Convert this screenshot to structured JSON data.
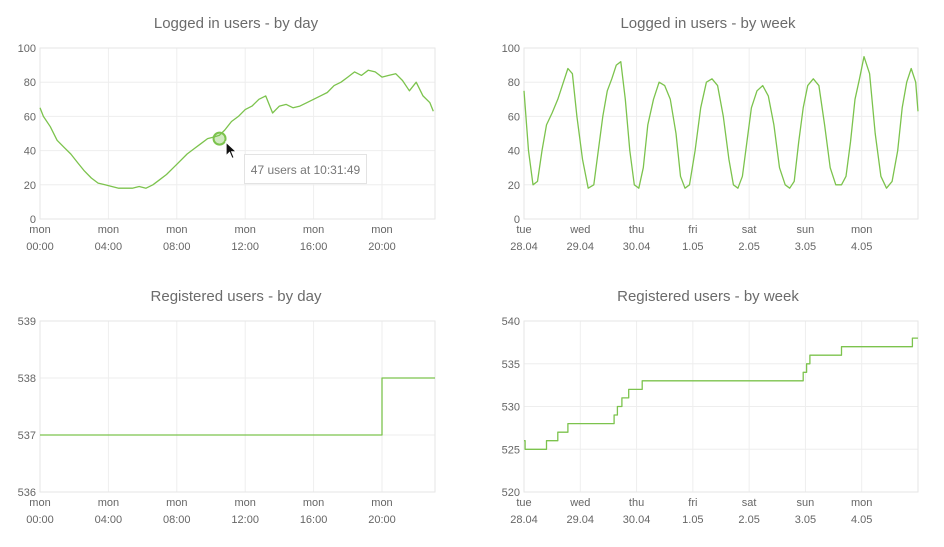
{
  "colors": {
    "line": "#7cc34d",
    "grid": "#eeeeee",
    "axis": "#e6e6e6",
    "text": "#666666"
  },
  "tooltip": {
    "text": "47 users at 10:31:49"
  },
  "chart_data": [
    {
      "id": "logged_day",
      "type": "line",
      "title": "Logged in users - by day",
      "xlabel": "",
      "ylabel": "",
      "ylim": [
        0,
        100
      ],
      "yticks": [
        0,
        20,
        40,
        60,
        80,
        100
      ],
      "xlim": [
        0,
        23.1
      ],
      "xticks": [
        {
          "x": 0,
          "l1": "mon",
          "l2": "00:00"
        },
        {
          "x": 4,
          "l1": "mon",
          "l2": "04:00"
        },
        {
          "x": 8,
          "l1": "mon",
          "l2": "08:00"
        },
        {
          "x": 12,
          "l1": "mon",
          "l2": "12:00"
        },
        {
          "x": 16,
          "l1": "mon",
          "l2": "16:00"
        },
        {
          "x": 20,
          "l1": "mon",
          "l2": "20:00"
        }
      ],
      "grid": true,
      "series": [
        {
          "x": [
            -0.2,
            0.2,
            0.6,
            1.0,
            1.4,
            1.8,
            2.2,
            2.6,
            3.0,
            3.4,
            3.8,
            4.2,
            4.6,
            5.0,
            5.4,
            5.8,
            6.2,
            6.6,
            7.0,
            7.4,
            7.8,
            8.2,
            8.6,
            9.0,
            9.4,
            9.8,
            10.2,
            10.5,
            10.8,
            11.2,
            11.6,
            12.0,
            12.4,
            12.8,
            13.2,
            13.6,
            14.0,
            14.4,
            14.8,
            15.2,
            15.6,
            16.0,
            16.4,
            16.8,
            17.2,
            17.6,
            18.0,
            18.4,
            18.8,
            19.2,
            19.6,
            20.0,
            20.4,
            20.8,
            21.2,
            21.6,
            22.0,
            22.4,
            22.8,
            23.0
          ],
          "y": [
            65,
            60,
            54,
            46,
            42,
            38,
            33,
            28,
            24,
            21,
            20,
            19,
            18,
            18,
            18,
            19,
            18,
            20,
            23,
            26,
            30,
            34,
            38,
            41,
            44,
            47,
            48,
            49,
            52,
            57,
            60,
            64,
            66,
            70,
            72,
            62,
            66,
            67,
            65,
            66,
            68,
            70,
            72,
            74,
            78,
            80,
            83,
            86,
            84,
            87,
            86,
            83,
            84,
            85,
            81,
            75,
            80,
            72,
            68,
            63
          ]
        }
      ]
    },
    {
      "id": "logged_week",
      "type": "line",
      "title": "Logged in users - by week",
      "xlabel": "",
      "ylabel": "",
      "ylim": [
        0,
        100
      ],
      "yticks": [
        0,
        20,
        40,
        60,
        80,
        100
      ],
      "xlim": [
        0,
        7.0
      ],
      "xticks": [
        {
          "x": 0,
          "l1": "tue",
          "l2": "28.04"
        },
        {
          "x": 1,
          "l1": "wed",
          "l2": "29.04"
        },
        {
          "x": 2,
          "l1": "thu",
          "l2": "30.04"
        },
        {
          "x": 3,
          "l1": "fri",
          "l2": "1.05"
        },
        {
          "x": 4,
          "l1": "sat",
          "l2": "2.05"
        },
        {
          "x": 5,
          "l1": "sun",
          "l2": "3.05"
        },
        {
          "x": 6,
          "l1": "mon",
          "l2": "4.05"
        }
      ],
      "grid": true,
      "series": [
        {
          "x": [
            0.0,
            0.08,
            0.16,
            0.24,
            0.32,
            0.4,
            0.5,
            0.6,
            0.7,
            0.78,
            0.86,
            0.94,
            1.04,
            1.14,
            1.24,
            1.32,
            1.4,
            1.48,
            1.56,
            1.64,
            1.72,
            1.8,
            1.88,
            1.96,
            2.04,
            2.12,
            2.2,
            2.3,
            2.4,
            2.5,
            2.6,
            2.7,
            2.78,
            2.86,
            2.94,
            3.04,
            3.14,
            3.24,
            3.34,
            3.44,
            3.54,
            3.64,
            3.72,
            3.8,
            3.88,
            3.96,
            4.04,
            4.14,
            4.24,
            4.34,
            4.44,
            4.54,
            4.64,
            4.72,
            4.8,
            4.88,
            4.96,
            5.04,
            5.14,
            5.24,
            5.34,
            5.44,
            5.54,
            5.64,
            5.72,
            5.8,
            5.88,
            5.96,
            6.04,
            6.14,
            6.24,
            6.34,
            6.44,
            6.54,
            6.64,
            6.72,
            6.8,
            6.88,
            6.96,
            7.0
          ],
          "y": [
            75,
            40,
            20,
            22,
            40,
            55,
            62,
            70,
            80,
            88,
            85,
            60,
            35,
            18,
            20,
            40,
            60,
            75,
            82,
            90,
            92,
            70,
            40,
            20,
            18,
            30,
            55,
            70,
            80,
            78,
            70,
            50,
            25,
            18,
            20,
            40,
            65,
            80,
            82,
            78,
            60,
            35,
            20,
            18,
            25,
            45,
            65,
            75,
            78,
            72,
            55,
            30,
            20,
            18,
            22,
            45,
            65,
            78,
            82,
            78,
            55,
            30,
            20,
            20,
            25,
            45,
            70,
            82,
            95,
            85,
            50,
            25,
            18,
            22,
            40,
            65,
            80,
            88,
            80,
            63
          ]
        }
      ]
    },
    {
      "id": "registered_day",
      "type": "line",
      "title": "Registered users - by day",
      "xlabel": "",
      "ylabel": "",
      "ylim": [
        536,
        539
      ],
      "yticks": [
        536,
        537,
        538,
        539
      ],
      "xlim": [
        0,
        23.1
      ],
      "xticks": [
        {
          "x": 0,
          "l1": "mon",
          "l2": "00:00"
        },
        {
          "x": 4,
          "l1": "mon",
          "l2": "04:00"
        },
        {
          "x": 8,
          "l1": "mon",
          "l2": "08:00"
        },
        {
          "x": 12,
          "l1": "mon",
          "l2": "12:00"
        },
        {
          "x": 16,
          "l1": "mon",
          "l2": "16:00"
        },
        {
          "x": 20,
          "l1": "mon",
          "l2": "20:00"
        }
      ],
      "grid": true,
      "series": [
        {
          "step": true,
          "x": [
            -0.2,
            20.0,
            23.1
          ],
          "y": [
            537,
            538,
            538
          ]
        }
      ]
    },
    {
      "id": "registered_week",
      "type": "line",
      "title": "Registered users - by week",
      "xlabel": "",
      "ylabel": "",
      "ylim": [
        520,
        540
      ],
      "yticks": [
        520,
        525,
        530,
        535,
        540
      ],
      "xlim": [
        0,
        7.0
      ],
      "xticks": [
        {
          "x": 0,
          "l1": "tue",
          "l2": "28.04"
        },
        {
          "x": 1,
          "l1": "wed",
          "l2": "29.04"
        },
        {
          "x": 2,
          "l1": "thu",
          "l2": "30.04"
        },
        {
          "x": 3,
          "l1": "fri",
          "l2": "1.05"
        },
        {
          "x": 4,
          "l1": "sat",
          "l2": "2.05"
        },
        {
          "x": 5,
          "l1": "sun",
          "l2": "3.05"
        },
        {
          "x": 6,
          "l1": "mon",
          "l2": "4.05"
        }
      ],
      "grid": true,
      "series": [
        {
          "step": true,
          "x": [
            0.0,
            0.02,
            0.4,
            0.6,
            0.78,
            1.6,
            1.66,
            1.74,
            1.86,
            2.0,
            2.1,
            4.96,
            5.02,
            5.08,
            5.64,
            6.84,
            6.9,
            7.0
          ],
          "y": [
            526,
            525,
            526,
            527,
            528,
            529,
            530,
            531,
            532,
            532,
            533,
            534,
            535,
            536,
            537,
            537,
            538,
            538
          ]
        }
      ]
    }
  ]
}
